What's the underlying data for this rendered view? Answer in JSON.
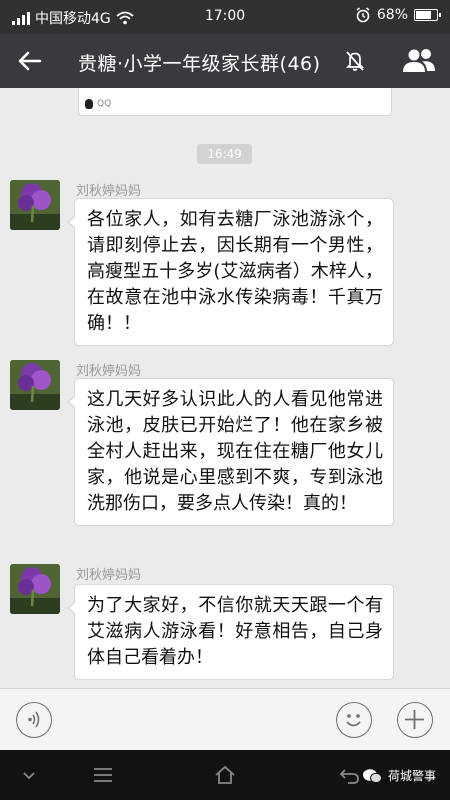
{
  "status_bar": {
    "carrier": "中国移动4G",
    "time": "17:00",
    "battery": "68%",
    "battery_level": 0.68
  },
  "header": {
    "title": "贵糖·小学一年级家长群(46)",
    "back_icon": "back-arrow-icon",
    "mute_icon": "bell-off-icon",
    "members_icon": "group-members-icon"
  },
  "chat": {
    "previous_card": {
      "source_label": "QQ"
    },
    "timestamp": "16:49",
    "messages": [
      {
        "sender": "刘秋婷妈妈",
        "text": "各位家人，如有去糖厂泳池游泳个，请即刻停止去，因长期有一个男性，高瘦型五十多岁(艾滋病者）木梓人，在故意在池中泳水传染病毒！千真万确！！"
      },
      {
        "sender": "刘秋婷妈妈",
        "text": "这几天好多认识此人的人看见他常进泳池，皮肤已开始烂了！他在家乡被全村人赶出来，现在住在糖厂他女儿家，他说是心里感到不爽，专到泳池洗那伤口，要多点人传染！真的！"
      },
      {
        "sender": "刘秋婷妈妈",
        "text": "为了大家好，不信你就天天跟一个有艾滋病人游泳看！好意相告，自己身体自己看着办！"
      }
    ]
  },
  "input_bar": {
    "voice_icon": "voice-input-icon",
    "emoji_icon": "emoji-icon",
    "more_icon": "plus-icon"
  },
  "navbar": {
    "icons": [
      "chevron-down-icon",
      "menu-icon",
      "home-icon",
      "back-icon"
    ],
    "watermark": "荷城警事"
  }
}
